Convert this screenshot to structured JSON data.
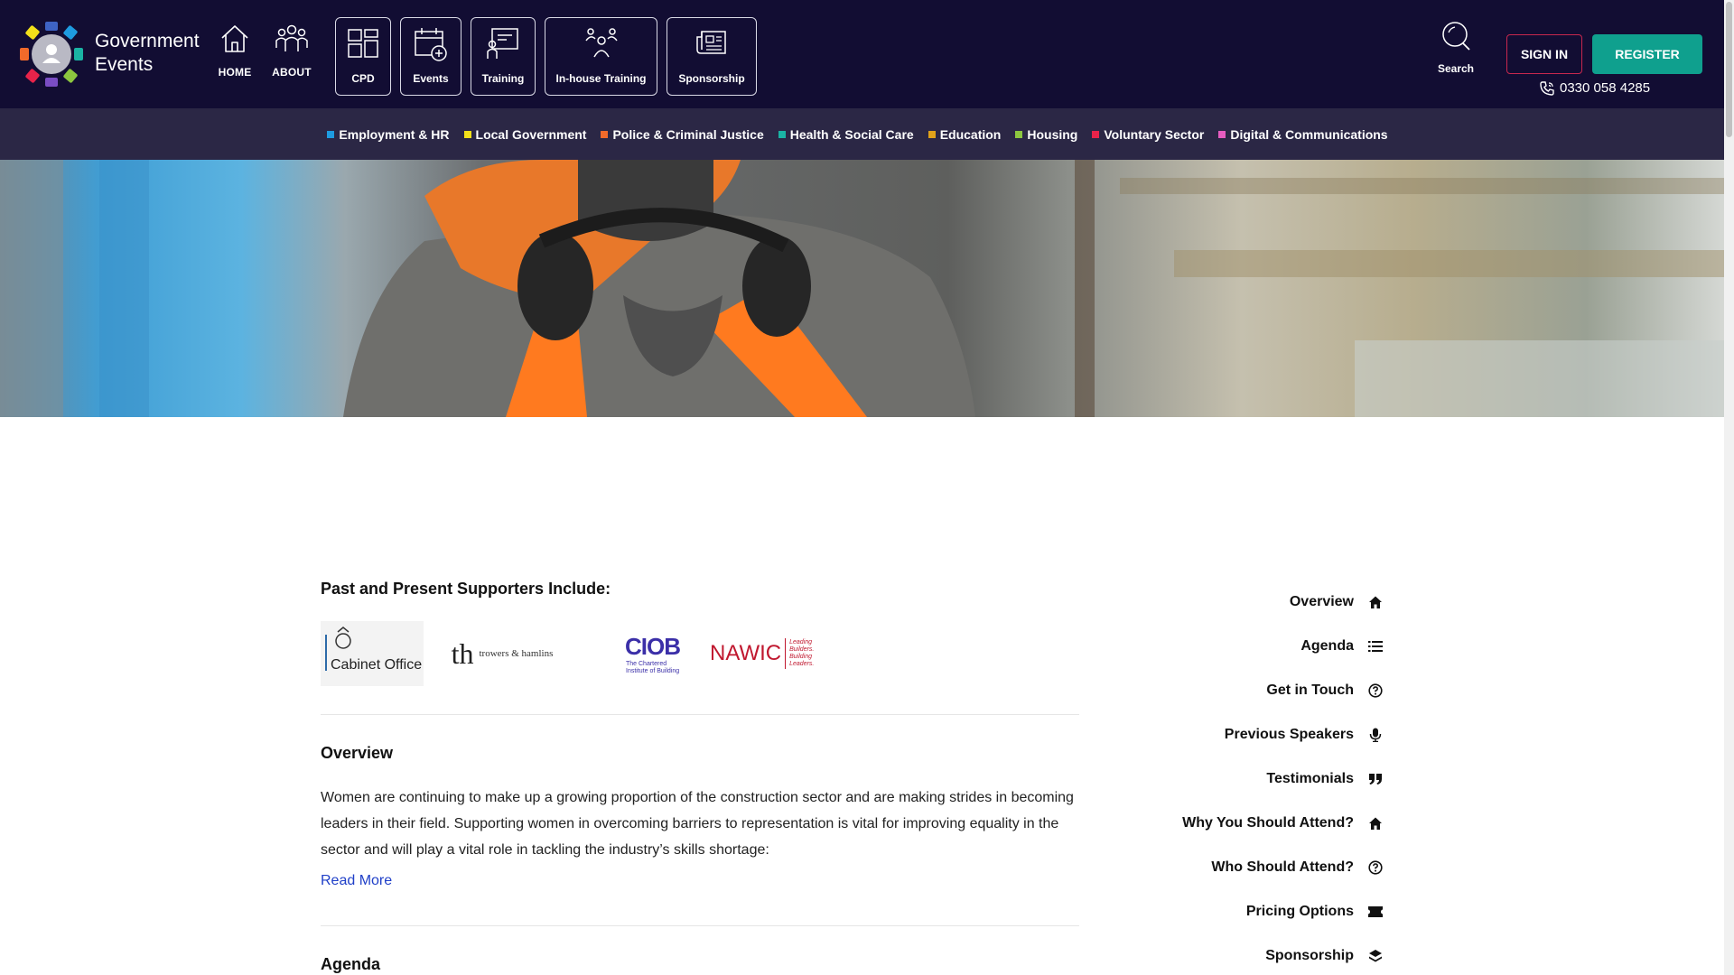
{
  "header": {
    "logo_text": [
      "Government",
      "Events"
    ],
    "nav_plain": [
      {
        "label": "HOME",
        "icon": "home-icon"
      },
      {
        "label": "ABOUT",
        "icon": "people-icon"
      }
    ],
    "nav_boxes": [
      {
        "label": "CPD",
        "icon": "dashboard-icon"
      },
      {
        "label": "Events",
        "icon": "calendar-add-icon"
      },
      {
        "label": "Training",
        "icon": "presenter-icon"
      },
      {
        "label": "In-house Training",
        "icon": "group-icon"
      },
      {
        "label": "Sponsorship",
        "icon": "newspaper-icon"
      }
    ],
    "search_label": "Search",
    "signin_label": "SIGN IN",
    "register_label": "REGISTER",
    "phone": "0330 058 4285",
    "colors": {
      "bar": "#120d33",
      "register": "#0fa08e",
      "signin_border": "#c8274e"
    }
  },
  "categories": [
    {
      "label": "Employment & HR",
      "color": "#1e9be0"
    },
    {
      "label": "Local Government",
      "color": "#f2e01a"
    },
    {
      "label": "Police & Criminal Justice",
      "color": "#f26a2a"
    },
    {
      "label": "Health & Social Care",
      "color": "#1ab3a4"
    },
    {
      "label": "Education",
      "color": "#e0a11a"
    },
    {
      "label": "Housing",
      "color": "#8cc63f"
    },
    {
      "label": "Voluntary Sector",
      "color": "#e8234a"
    },
    {
      "label": "Digital & Communications",
      "color": "#e65cc0"
    }
  ],
  "supporters": {
    "title": "Past and Present Supporters Include:",
    "logos": [
      {
        "name": "Cabinet Office",
        "text": "Cabinet Office"
      },
      {
        "name": "trowers & hamlins",
        "text": "trowers & hamlins"
      },
      {
        "name": "CIOB",
        "text": "CIOB",
        "subtext": "The Chartered Institute of Building"
      },
      {
        "name": "NAWIC",
        "text": "NAWIC",
        "subtext": "Leading Builders. Building Leaders."
      }
    ]
  },
  "overview": {
    "title": "Overview",
    "text": "Women are continuing to make up a growing proportion of the construction sector and are making strides in becoming leaders in their field. Supporting women in overcoming barriers to representation is vital for improving equality in the sector and will play a vital role in tackling the industry’s skills shortage:",
    "read_more": "Read More"
  },
  "agenda": {
    "title": "Agenda"
  },
  "side_nav": [
    {
      "label": "Overview",
      "icon": "home-icon"
    },
    {
      "label": "Agenda",
      "icon": "list-icon"
    },
    {
      "label": "Get in Touch",
      "icon": "question-circle-icon"
    },
    {
      "label": "Previous Speakers",
      "icon": "microphone-icon"
    },
    {
      "label": "Testimonials",
      "icon": "quote-icon"
    },
    {
      "label": "Why You Should Attend?",
      "icon": "home-icon"
    },
    {
      "label": "Who Should Attend?",
      "icon": "question-circle-icon"
    },
    {
      "label": "Pricing Options",
      "icon": "ticket-icon"
    },
    {
      "label": "Sponsorship",
      "icon": "layers-icon"
    }
  ]
}
